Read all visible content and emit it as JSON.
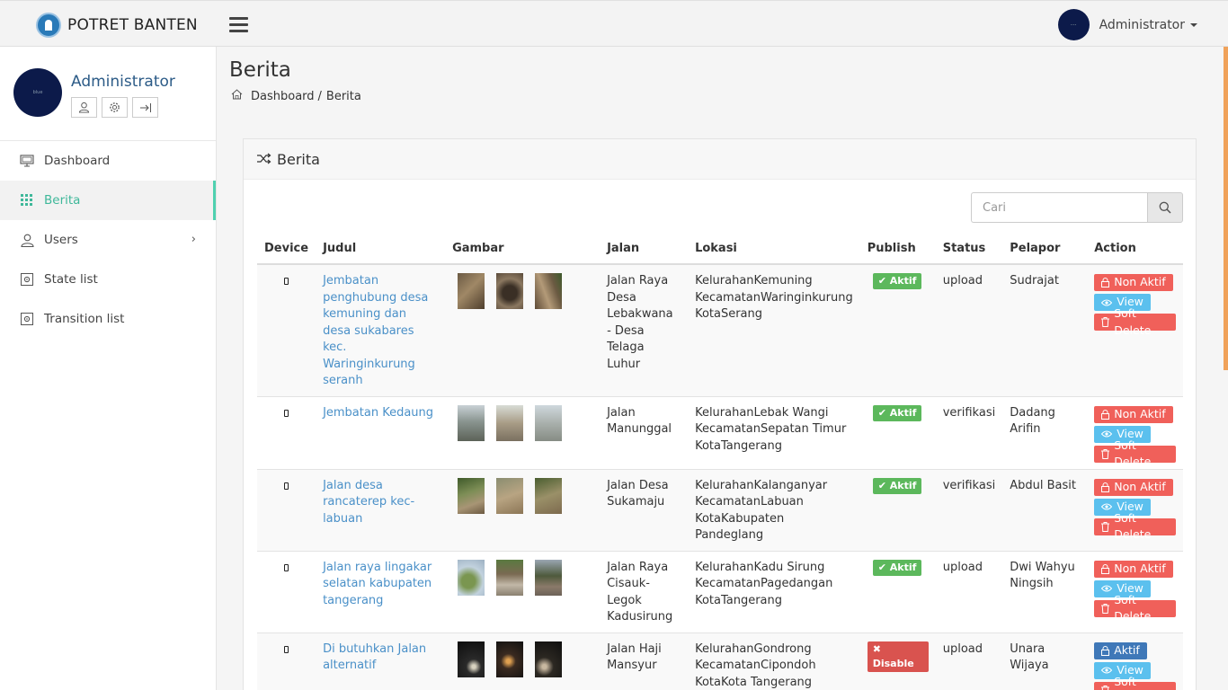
{
  "brand": {
    "name": "POTRET BANTEN"
  },
  "topbar": {
    "user_name": "Administrator",
    "avatar_text": "···"
  },
  "sidebar": {
    "profile_name": "Administrator",
    "avatar_text": "blue",
    "items": [
      {
        "label": "Dashboard",
        "icon": "monitor-icon"
      },
      {
        "label": "Berita",
        "icon": "grid-icon",
        "active": true
      },
      {
        "label": "Users",
        "icon": "user-icon"
      },
      {
        "label": "State list",
        "icon": "settings-icon"
      },
      {
        "label": "Transition list",
        "icon": "settings-icon"
      }
    ]
  },
  "page": {
    "title": "Berita",
    "breadcrumb": [
      "Dashboard",
      "Berita"
    ],
    "breadcrumb_sep": "/"
  },
  "panel": {
    "title": "Berita",
    "search_placeholder": "Cari"
  },
  "table": {
    "headers": [
      "Device",
      "Judul",
      "Gambar",
      "Jalan",
      "Lokasi",
      "Publish",
      "Status",
      "Pelapor",
      "Action"
    ],
    "rows": [
      {
        "judul": "Jembatan penghubung desa kemuning dan desa sukabares kec. Waringinkurung seranh",
        "jalan": "Jalan Raya Desa Lebakwana - Desa Telaga Luhur",
        "lokasi": [
          "KelurahanKemuning",
          "KecamatanWaringinkurung",
          "KotaSerang"
        ],
        "publish": "Aktif",
        "status": "upload",
        "pelapor": "Sudrajat",
        "actions": [
          "Non Aktif",
          "View",
          "Soft Delete"
        ]
      },
      {
        "judul": "Jembatan Kedaung",
        "jalan": "Jalan Manunggal",
        "lokasi": [
          "KelurahanLebak Wangi",
          "KecamatanSepatan Timur",
          "KotaTangerang"
        ],
        "publish": "Aktif",
        "status": "verifikasi",
        "pelapor": "Dadang Arifin",
        "actions": [
          "Non Aktif",
          "View",
          "Soft Delete"
        ]
      },
      {
        "judul": "Jalan desa rancaterep kec-labuan",
        "jalan": "Jalan Desa Sukamaju",
        "lokasi": [
          "KelurahanKalanganyar",
          "KecamatanLabuan",
          "KotaKabupaten Pandeglang"
        ],
        "publish": "Aktif",
        "status": "verifikasi",
        "pelapor": "Abdul Basit",
        "actions": [
          "Non Aktif",
          "View",
          "Soft Delete"
        ]
      },
      {
        "judul": "Jalan raya lingakar selatan kabupaten tangerang",
        "jalan": "Jalan Raya Cisauk-Legok Kadusirung",
        "lokasi": [
          "KelurahanKadu Sirung",
          "KecamatanPagedangan",
          "KotaTangerang"
        ],
        "publish": "Aktif",
        "status": "upload",
        "pelapor": "Dwi Wahyu Ningsih",
        "actions": [
          "Non Aktif",
          "View",
          "Soft Delete"
        ]
      },
      {
        "judul": "Di butuhkan Jalan alternatif",
        "jalan": "Jalan Haji Mansyur",
        "lokasi": [
          "KelurahanGondrong",
          "KecamatanCipondoh",
          "KotaKota Tangerang"
        ],
        "publish": "Disable",
        "status": "upload",
        "pelapor": "Unara Wijaya",
        "actions": [
          "Aktif",
          "View",
          "Soft Delete"
        ]
      }
    ]
  },
  "colors": {
    "accent": "#3fb89a",
    "link": "#4a90c8",
    "badge_active": "#5cb85c",
    "badge_disable": "#d9534f",
    "btn_red": "#f0605a",
    "btn_blue": "#5bc0ee",
    "btn_dark_blue": "#3f78b8"
  }
}
